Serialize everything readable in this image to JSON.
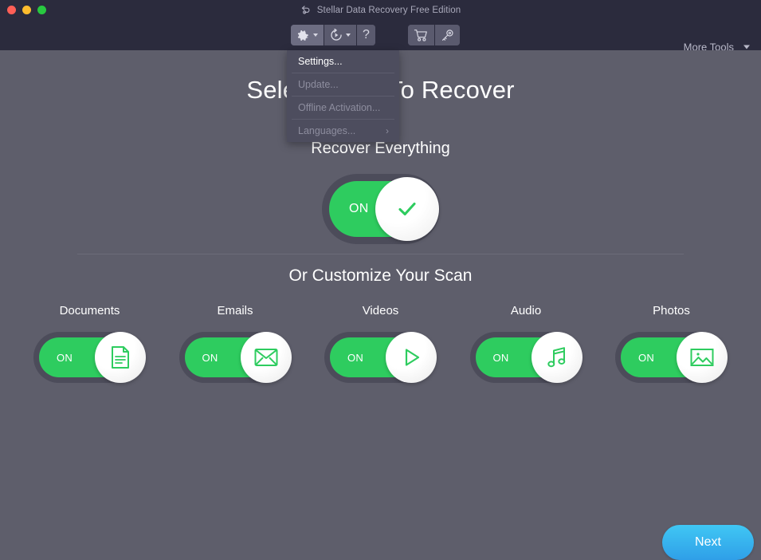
{
  "window": {
    "title": "Stellar Data Recovery Free Edition",
    "back_icon": "undo-arrow-icon",
    "traffic_lights": [
      "close",
      "minimize",
      "zoom"
    ]
  },
  "toolbar": {
    "settings_icon": "gear-icon",
    "settings_caret": "chevron-down-icon",
    "resume_icon": "resume-recovery-icon",
    "resume_caret": "chevron-down-icon",
    "help_label": "?",
    "cart_icon": "shopping-cart-icon",
    "key_icon": "activation-key-icon",
    "more_tools_label": "More Tools",
    "more_tools_caret": "chevron-down-icon"
  },
  "settings_menu": {
    "items": [
      {
        "label": "Settings...",
        "highlighted": true,
        "submenu": false
      },
      {
        "label": "Update...",
        "highlighted": false,
        "submenu": false
      },
      {
        "label": "Offline Activation...",
        "highlighted": false,
        "submenu": false
      },
      {
        "label": "Languages...",
        "highlighted": false,
        "submenu": true
      }
    ],
    "submenu_arrow": "›"
  },
  "main": {
    "heading": "Select What To Recover",
    "subheading": "Recover Everything",
    "master_toggle": {
      "state_label": "ON",
      "icon": "check-icon",
      "on": true
    },
    "customize_heading": "Or Customize Your Scan",
    "categories": [
      {
        "label": "Documents",
        "state_label": "ON",
        "icon": "document-icon",
        "on": true
      },
      {
        "label": "Emails",
        "state_label": "ON",
        "icon": "envelope-icon",
        "on": true
      },
      {
        "label": "Videos",
        "state_label": "ON",
        "icon": "play-icon",
        "on": true
      },
      {
        "label": "Audio",
        "state_label": "ON",
        "icon": "music-note-icon",
        "on": true
      },
      {
        "label": "Photos",
        "state_label": "ON",
        "icon": "image-icon",
        "on": true
      }
    ]
  },
  "footer": {
    "next_label": "Next"
  },
  "colors": {
    "header_bg": "#2b2b3d",
    "content_bg": "#5e5e6b",
    "toggle_track": "#4c4c5a",
    "accent_green": "#2ecc5f",
    "next_blue": "#40c7f4",
    "menu_bg": "#4d4d5e"
  }
}
